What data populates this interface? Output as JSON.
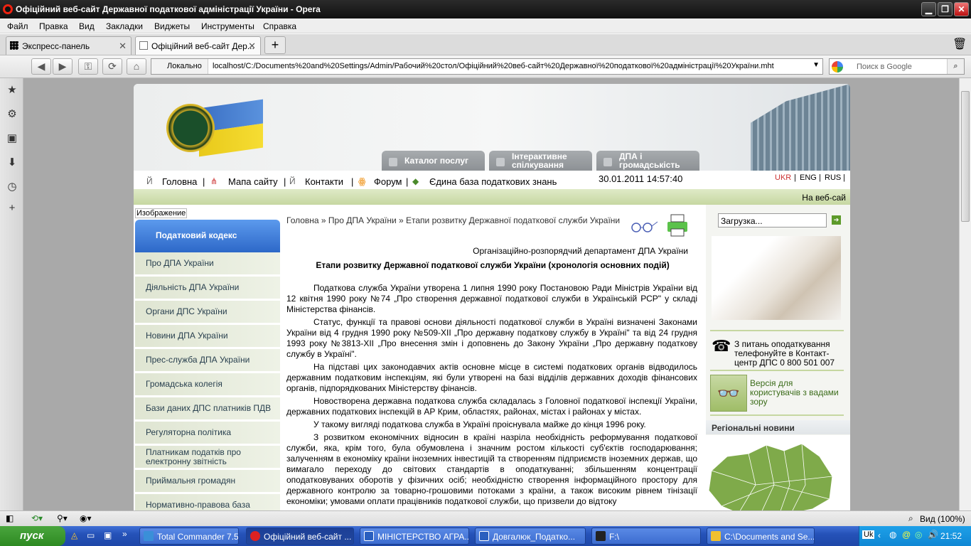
{
  "window": {
    "title": "Офіційний веб-сайт Державної податкової адміністрації України - Opera"
  },
  "menu": [
    "Файл",
    "Правка",
    "Вид",
    "Закладки",
    "Виджеты",
    "Инструменты",
    "Справка"
  ],
  "tabs": [
    {
      "label": "Экспресс-панель"
    },
    {
      "label": "Офіційний веб-сайт Дер..."
    }
  ],
  "address": {
    "location_label": "Локально",
    "url": "localhost/C:/Documents%20and%20Settings/Admin/Рабочий%20стол/Офіційний%20веб-сайт%20Державної%20податкової%20адміністрації%20України.mht",
    "search_placeholder": "Поиск в Google"
  },
  "site": {
    "header_tabs": [
      "Каталог послуг",
      "Інтерактивне спілкування",
      "ДПА і громадськість"
    ],
    "nav": {
      "home": "Головна",
      "sitemap": "Мапа сайту",
      "contacts": "Контакти",
      "forum": "Форум",
      "knowledge": "Єдина база податкових знань",
      "datetime": "30.01.2011 14:57:40",
      "lang": [
        "UKR",
        "ENG",
        "RUS"
      ]
    },
    "greenbar_text": "На веб-сай",
    "image_alt": "Изображение",
    "code_button": "Податковий кодекс",
    "left_menu": [
      "Про ДПА України",
      "Діяльність ДПА України",
      "Органи ДПС України",
      "Новини ДПА України",
      "Прес-служба ДПА України",
      "Громадська колегія",
      "Бази даних ДПС платників ПДВ",
      "Регуляторна політика",
      "Платникам податків про електронну звітність",
      "Приймальня громадян",
      "Нормативно-правова база"
    ],
    "breadcrumb": "Головна » Про ДПА України » Етапи розвитку Державної податкової служби України",
    "department": "Організаційно-розпорядчий департамент ДПА України",
    "headline": "Етапи розвитку Державної податкової служби України (хронологія основних подій)",
    "paragraphs": [
      "Податкова служба України утворена 1 липня 1990 року Постановою Ради Міністрів України від 12 квітня 1990 року №74 „Про створення державної податкової служби в Українській РСР\" у складі Міністерства фінансів.",
      "Статус, функції та правові основи діяльності податкової служби в Україні визначені Законами України від 4 грудня 1990 року №509-XII „Про державну податкову службу в Україні\" та від 24 грудня 1993 року №3813-XII „Про внесення змін і доповнень до Закону України „Про державну податкову службу в Україні\".",
      "На підставі цих законодавчих актів основне місце в системі податкових органів відводилось державним податковим інспекціям, які були утворені на базі відділів державних доходів фінансових органів, підпорядкованих Міністерству фінансів.",
      "Новостворена державна податкова служба складалась з Головної податкової інспекції України, державних податкових інспекцій в АР Крим, областях, районах, містах і районах у містах.",
      "У такому вигляді податкова служба в Україні проіснувала майже до кінця 1996 року.",
      "З розвитком економічних відносин в країні назріла необхідність реформування податкової служби, яка, крім того, була обумовлена і значним ростом кількості суб'єктів господарювання; залученням в економіку країни іноземних інвестицій та створенням підприємств іноземних держав, що вимагало переходу до світових стандартів в оподаткуванні; збільшенням концентрації оподатковуваних оборотів у фізичних осіб; необхідністю створення інформаційного простору для державного контролю за товарно-грошовими потоками з країни, а також високим рівнем тінізації економіки; умовами оплати працівників податкової служби, що призвели до відтоку"
    ],
    "search_value": "Загрузка...",
    "phone_text": "З питань оподаткування телефонуйте в Контакт-центр ДПС 0 800 501 007",
    "vision_text": "Версія для користувачів з вадами зору",
    "regional_title": "Регіональні новини"
  },
  "status": {
    "zoom": "Вид (100%)"
  },
  "taskbar": {
    "start": "пуск",
    "items": [
      "Total Commander 7.5...",
      "Офіційний веб-сайт ...",
      "МІНІСТЕРСТВО АГРА...",
      "Довгалюк_Податко...",
      "F:\\",
      "C:\\Documents and Se..."
    ],
    "lang": "Uk",
    "clock": "21:52"
  }
}
